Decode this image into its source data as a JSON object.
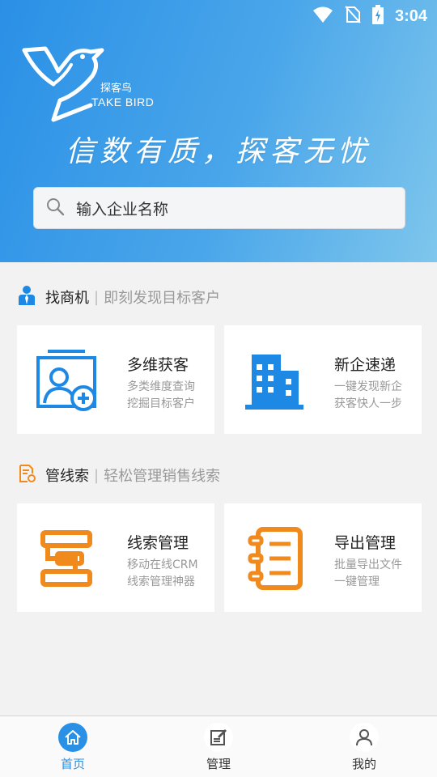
{
  "status_bar": {
    "time": "3:04"
  },
  "brand": {
    "name_cn": "探客鸟",
    "name_en": "TAKE BIRD",
    "slogan": "信数有质，探客无忧"
  },
  "search": {
    "placeholder": "输入企业名称"
  },
  "sections": [
    {
      "title": "找商机",
      "separator": "|",
      "subtitle": "即刻发现目标客户",
      "icon": "person-tie-icon",
      "cards": [
        {
          "title": "多维获客",
          "desc_line1": "多类维度查询",
          "desc_line2": "挖掘目标客户",
          "icon": "contact-add-icon"
        },
        {
          "title": "新企速递",
          "desc_line1": "一键发现新企",
          "desc_line2": "获客快人一步",
          "icon": "buildings-icon"
        }
      ]
    },
    {
      "title": "管线索",
      "separator": "|",
      "subtitle": "轻松管理销售线索",
      "icon": "document-gear-icon",
      "cards": [
        {
          "title": "线索管理",
          "desc_line1": "移动在线CRM",
          "desc_line2": "线索管理神器",
          "icon": "flow-icon"
        },
        {
          "title": "导出管理",
          "desc_line1": "批量导出文件",
          "desc_line2": "一键管理",
          "icon": "notebook-icon"
        }
      ]
    }
  ],
  "tabbar": {
    "items": [
      {
        "label": "首页",
        "icon": "home-icon",
        "active": true
      },
      {
        "label": "管理",
        "icon": "edit-icon",
        "active": false
      },
      {
        "label": "我的",
        "icon": "user-icon",
        "active": false
      }
    ]
  },
  "colors": {
    "primary": "#2a90e6",
    "accent_orange": "#f08a1c",
    "icon_blue": "#1e88e5"
  }
}
